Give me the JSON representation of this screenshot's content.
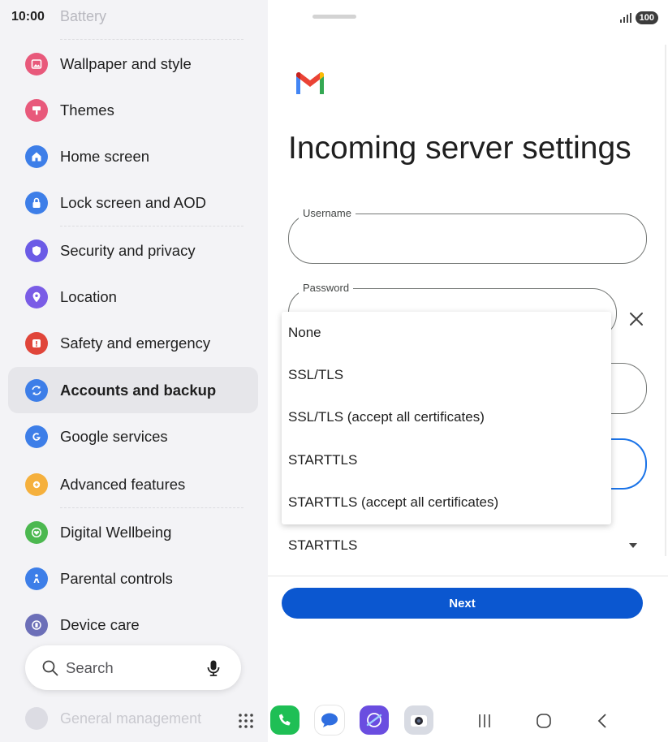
{
  "status_bar": {
    "time": "10:00",
    "battery": "100"
  },
  "sidebar": {
    "faded_top_label": "Battery",
    "faded_bottom_label": "General management",
    "items": [
      {
        "label": "Wallpaper and style",
        "icon": "wallpaper-icon",
        "color": "#e8597b"
      },
      {
        "label": "Themes",
        "icon": "themes-brush-icon",
        "color": "#e8597b"
      },
      {
        "label": "Home screen",
        "icon": "home-icon",
        "color": "#3d7ee8"
      },
      {
        "label": "Lock screen and AOD",
        "icon": "lock-icon",
        "color": "#3d7ee8"
      },
      {
        "label": "Security and privacy",
        "icon": "shield-icon",
        "color": "#6b5be6"
      },
      {
        "label": "Location",
        "icon": "location-pin-icon",
        "color": "#7a5ce6"
      },
      {
        "label": "Safety and emergency",
        "icon": "emergency-icon",
        "color": "#e0453a"
      },
      {
        "label": "Accounts and backup",
        "icon": "sync-icon",
        "color": "#3d7ee8",
        "selected": true
      },
      {
        "label": "Google services",
        "icon": "google-icon",
        "color": "#3d7ee8"
      },
      {
        "label": "Advanced features",
        "icon": "gear-plus-icon",
        "color": "#f5b03d"
      },
      {
        "label": "Digital Wellbeing",
        "icon": "wellbeing-heart-icon",
        "color": "#4cb850"
      },
      {
        "label": "Parental controls",
        "icon": "parental-icon",
        "color": "#3d7ee8"
      },
      {
        "label": "Device care",
        "icon": "device-care-icon",
        "color": "#6c6fb8"
      }
    ],
    "search": {
      "placeholder": "Search"
    }
  },
  "main": {
    "title": "Incoming server settings",
    "username_label": "Username",
    "password_label": "Password",
    "security_value": "STARTTLS",
    "next_label": "Next"
  },
  "dropdown": {
    "options": [
      "None",
      "SSL/TLS",
      "SSL/TLS (accept all certificates)",
      "STARTTLS",
      "STARTTLS (accept all certificates)"
    ]
  },
  "taskbar": {
    "apps": [
      {
        "name": "phone-app-icon",
        "color": "#1fbf55"
      },
      {
        "name": "messages-app-icon",
        "color": "#ffffff"
      },
      {
        "name": "internet-app-icon",
        "color": "#6a4de0"
      },
      {
        "name": "camera-app-icon",
        "color": "#d8dbe3"
      }
    ]
  }
}
